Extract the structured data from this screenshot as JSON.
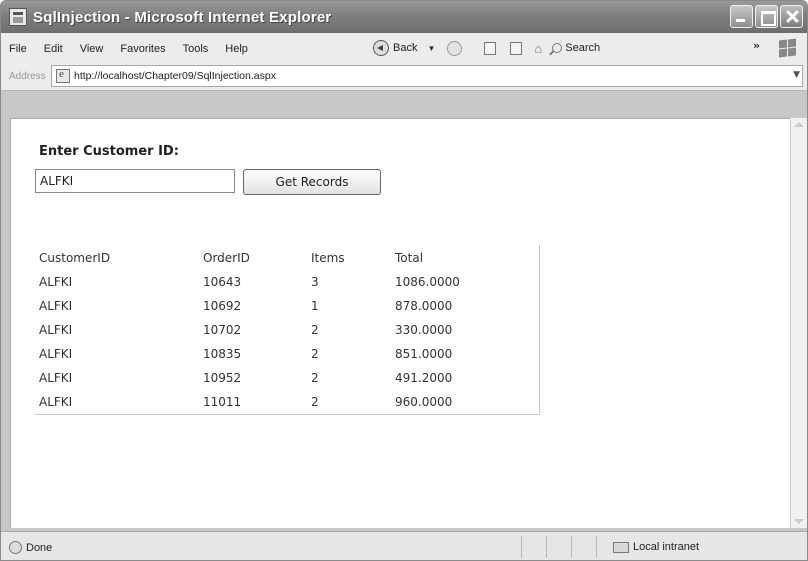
{
  "window": {
    "title": "SqlInjection - Microsoft Internet Explorer"
  },
  "menu": {
    "items": [
      "File",
      "Edit",
      "View",
      "Favorites",
      "Tools",
      "Help"
    ]
  },
  "toolbar": {
    "back_label": "Back",
    "search_label": "Search"
  },
  "address": {
    "label": "Address",
    "url": "http://localhost/Chapter09/SqlInjection.aspx"
  },
  "form": {
    "prompt": "Enter Customer ID:",
    "customer_id": "ALFKI",
    "button_label": "Get Records"
  },
  "grid": {
    "headers": [
      "CustomerID",
      "OrderID",
      "Items",
      "Total"
    ],
    "rows": [
      [
        "ALFKI",
        "10643",
        "3",
        "1086.0000"
      ],
      [
        "ALFKI",
        "10692",
        "1",
        "878.0000"
      ],
      [
        "ALFKI",
        "10702",
        "2",
        "330.0000"
      ],
      [
        "ALFKI",
        "10835",
        "2",
        "851.0000"
      ],
      [
        "ALFKI",
        "10952",
        "2",
        "491.2000"
      ],
      [
        "ALFKI",
        "11011",
        "2",
        "960.0000"
      ]
    ]
  },
  "status": {
    "left_text": "Done",
    "zone_text": "Local intranet"
  }
}
